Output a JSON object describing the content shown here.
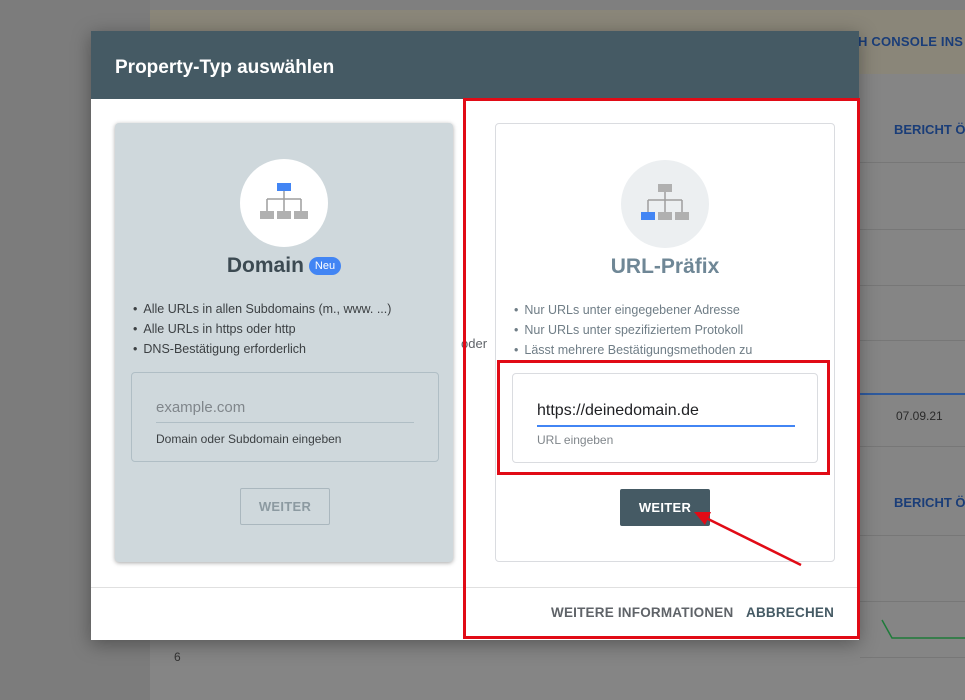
{
  "background": {
    "banner_link": "H CONSOLE INS",
    "report_link_1": "BERICHT Ö",
    "report_link_2": "BERICHT Ö",
    "date": "07.09.21",
    "axis_value": "6"
  },
  "dialog": {
    "title": "Property-Typ auswählen",
    "separator": "oder",
    "domain_card": {
      "icon": "sitemap-icon",
      "title": "Domain",
      "badge": "Neu",
      "bullets": [
        "Alle URLs in allen Subdomains (m., www. ...)",
        "Alle URLs in https oder http",
        "DNS-Bestätigung erforderlich"
      ],
      "input_placeholder": "example.com",
      "input_value": "",
      "input_help": "Domain oder Subdomain eingeben",
      "button": "WEITER"
    },
    "url_card": {
      "icon": "sitemap-icon",
      "title": "URL-Präfix",
      "bullets": [
        "Nur URLs unter eingegebener Adresse",
        "Nur URLs unter spezifiziertem Protokoll",
        "Lässt mehrere Bestätigungsmethoden zu"
      ],
      "input_value": "https://deinedomain.de",
      "input_help": "URL eingeben",
      "button": "WEITER"
    },
    "footer": {
      "more_info": "WEITERE INFORMATIONEN",
      "cancel": "ABBRECHEN"
    }
  },
  "colors": {
    "header": "#455a64",
    "domain_card": "#cfd8dc",
    "accent_blue": "#4285f4",
    "annotation_red": "#e10b16"
  }
}
